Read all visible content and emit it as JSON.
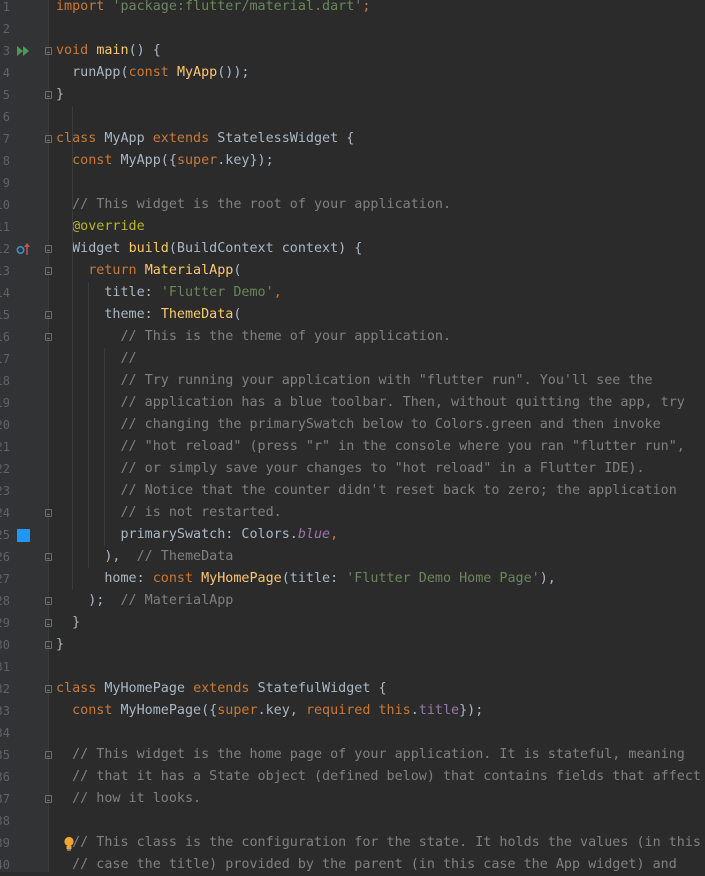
{
  "editor": {
    "lines": [
      {
        "n": "1",
        "segs": [
          [
            "kw",
            "import "
          ],
          [
            "str",
            "'package:flutter/material.dart'"
          ],
          [
            "kw",
            ";"
          ]
        ]
      },
      {
        "n": "2",
        "segs": []
      },
      {
        "n": "3",
        "segs": [
          [
            "kw",
            "void "
          ],
          [
            "fn",
            "main"
          ],
          [
            "cls",
            "() {"
          ]
        ],
        "icon": "run"
      },
      {
        "n": "4",
        "segs": [
          [
            "cls",
            "  runApp("
          ],
          [
            "kw",
            "const "
          ],
          [
            "fn",
            "MyApp"
          ],
          [
            "cls",
            "());"
          ]
        ]
      },
      {
        "n": "5",
        "segs": [
          [
            "cls",
            "}"
          ]
        ]
      },
      {
        "n": "6",
        "segs": []
      },
      {
        "n": "7",
        "segs": [
          [
            "kw",
            "class "
          ],
          [
            "cls",
            "MyApp "
          ],
          [
            "kw",
            "extends "
          ],
          [
            "cls",
            "StatelessWidget {"
          ]
        ]
      },
      {
        "n": "8",
        "segs": [
          [
            "kw",
            "  const "
          ],
          [
            "cls",
            "MyApp({"
          ],
          [
            "kw",
            "super"
          ],
          [
            "cls",
            ".key});"
          ]
        ]
      },
      {
        "n": "9",
        "segs": []
      },
      {
        "n": "10",
        "segs": [
          [
            "cm",
            "  // This widget is the root of your application."
          ]
        ]
      },
      {
        "n": "11",
        "segs": [
          [
            "ann",
            "  @override"
          ]
        ]
      },
      {
        "n": "12",
        "segs": [
          [
            "cls",
            "  Widget "
          ],
          [
            "fn",
            "build"
          ],
          [
            "cls",
            "(BuildContext context) {"
          ]
        ],
        "icon": "override"
      },
      {
        "n": "13",
        "segs": [
          [
            "kw",
            "    return "
          ],
          [
            "fn",
            "MaterialApp"
          ],
          [
            "cls",
            "("
          ]
        ]
      },
      {
        "n": "14",
        "segs": [
          [
            "cls",
            "      title: "
          ],
          [
            "str",
            "'Flutter Demo'"
          ],
          [
            "kw",
            ","
          ]
        ]
      },
      {
        "n": "15",
        "segs": [
          [
            "cls",
            "      theme: "
          ],
          [
            "fn",
            "ThemeData"
          ],
          [
            "cls",
            "("
          ]
        ]
      },
      {
        "n": "16",
        "segs": [
          [
            "cm",
            "        // This is the theme of your application."
          ]
        ]
      },
      {
        "n": "17",
        "segs": [
          [
            "cm",
            "        //"
          ]
        ]
      },
      {
        "n": "18",
        "segs": [
          [
            "cm",
            "        // Try running your application with \"flutter run\". You'll see the"
          ]
        ]
      },
      {
        "n": "19",
        "segs": [
          [
            "cm",
            "        // application has a blue toolbar. Then, without quitting the app, try"
          ]
        ]
      },
      {
        "n": "20",
        "segs": [
          [
            "cm",
            "        // changing the primarySwatch below to Colors.green and then invoke"
          ]
        ]
      },
      {
        "n": "21",
        "segs": [
          [
            "cm",
            "        // \"hot reload\" (press \"r\" in the console where you ran \"flutter run\","
          ]
        ]
      },
      {
        "n": "22",
        "segs": [
          [
            "cm",
            "        // or simply save your changes to \"hot reload\" in a Flutter IDE)."
          ]
        ]
      },
      {
        "n": "23",
        "segs": [
          [
            "cm",
            "        // Notice that the counter didn't reset back to zero; the application"
          ]
        ]
      },
      {
        "n": "24",
        "segs": [
          [
            "cm",
            "        // is not restarted."
          ]
        ]
      },
      {
        "n": "25",
        "segs": [
          [
            "cls",
            "        primarySwatch: Colors."
          ],
          [
            "fldi",
            "blue"
          ],
          [
            "kw",
            ","
          ]
        ],
        "icon": "color"
      },
      {
        "n": "26",
        "segs": [
          [
            "cls",
            "      ),"
          ],
          [
            "cm",
            "  // ThemeData"
          ]
        ]
      },
      {
        "n": "27",
        "segs": [
          [
            "cls",
            "      home: "
          ],
          [
            "kw",
            "const "
          ],
          [
            "fn",
            "MyHomePage"
          ],
          [
            "cls",
            "(title: "
          ],
          [
            "str",
            "'Flutter Demo Home Page'"
          ],
          [
            "cls",
            "),"
          ]
        ]
      },
      {
        "n": "28",
        "segs": [
          [
            "cls",
            "    );"
          ],
          [
            "cm",
            "  // MaterialApp"
          ]
        ]
      },
      {
        "n": "29",
        "segs": [
          [
            "cls",
            "  }"
          ]
        ]
      },
      {
        "n": "30",
        "segs": [
          [
            "cls",
            "}"
          ]
        ]
      },
      {
        "n": "31",
        "segs": []
      },
      {
        "n": "32",
        "segs": [
          [
            "kw",
            "class "
          ],
          [
            "cls",
            "MyHomePage "
          ],
          [
            "kw",
            "extends "
          ],
          [
            "cls",
            "StatefulWidget {"
          ]
        ]
      },
      {
        "n": "33",
        "segs": [
          [
            "kw",
            "  const "
          ],
          [
            "cls",
            "MyHomePage({"
          ],
          [
            "kw",
            "super"
          ],
          [
            "cls",
            ".key, "
          ],
          [
            "kw",
            "required this"
          ],
          [
            "cls",
            "."
          ],
          [
            "fld",
            "title"
          ],
          [
            "cls",
            "});"
          ]
        ]
      },
      {
        "n": "34",
        "segs": []
      },
      {
        "n": "35",
        "segs": [
          [
            "cm",
            "  // This widget is the home page of your application. It is stateful, meaning"
          ]
        ]
      },
      {
        "n": "36",
        "segs": [
          [
            "cm",
            "  // that it has a State object (defined below) that contains fields that affect"
          ]
        ]
      },
      {
        "n": "37",
        "segs": [
          [
            "cm",
            "  // how it looks."
          ]
        ]
      },
      {
        "n": "38",
        "segs": []
      },
      {
        "n": "39",
        "segs": [
          [
            "cm",
            "  // This class is the configuration for the state. It holds the values (in this"
          ]
        ],
        "icon": "bulb"
      },
      {
        "n": "40",
        "segs": [
          [
            "cm",
            "  // case the title) provided by the parent (in this case the App widget) and"
          ]
        ]
      }
    ],
    "fold_lines": [
      3,
      5,
      7,
      12,
      13,
      15,
      16,
      24,
      26,
      28,
      29,
      30,
      32,
      35,
      37
    ],
    "colors": {
      "background": "#2b2b2b",
      "gutter": "#313335",
      "keyword": "#cc7832",
      "string": "#6a8759",
      "comment": "#808080",
      "function": "#ffc66d",
      "annotation": "#bbb529",
      "field": "#9876aa",
      "swatch": "#2196f3"
    },
    "icons": {
      "run": "run-gutter-icon",
      "override": "override-gutter-icon",
      "color": "color-swatch-icon",
      "bulb": "intention-bulb-icon"
    }
  }
}
